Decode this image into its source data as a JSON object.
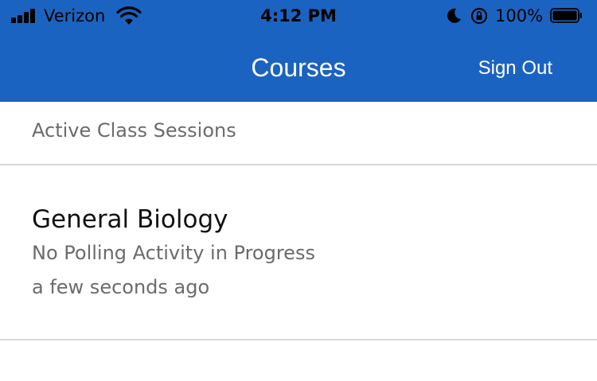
{
  "status_bar": {
    "carrier": "Verizon",
    "time": "4:12 PM",
    "battery_percent": "100%",
    "icons": [
      "signal-icon",
      "wifi-icon",
      "moon-icon",
      "rotation-lock-icon",
      "battery-icon"
    ]
  },
  "nav": {
    "title": "Courses",
    "sign_out_label": "Sign Out",
    "background_color": "#1b63c0"
  },
  "section": {
    "header": "Active Class Sessions"
  },
  "courses": [
    {
      "name": "General Biology",
      "status": "No Polling Activity in Progress",
      "updated": "a few seconds ago"
    }
  ]
}
